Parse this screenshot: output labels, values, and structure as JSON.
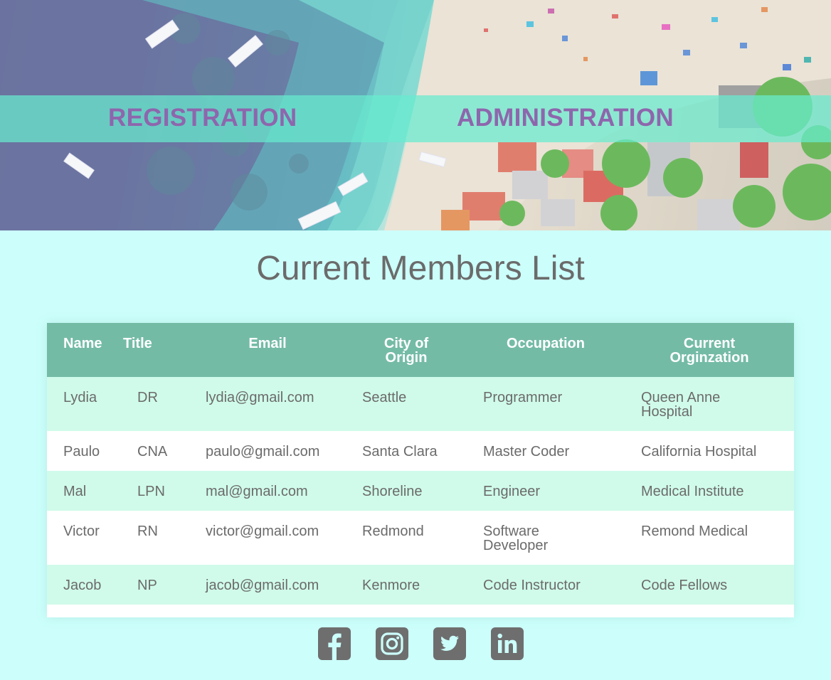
{
  "nav": {
    "registration": "REGISTRATION",
    "administration": "ADMINISTRATION"
  },
  "page_title": "Current Members List",
  "table": {
    "headers": {
      "name": "Name",
      "title": "Title",
      "email": "Email",
      "city_line1": "City of",
      "city_line2": "Origin",
      "occupation": "Occupation",
      "org_line1": "Current",
      "org_line2": "Orginzation"
    },
    "rows": [
      {
        "name": "Lydia",
        "title": "DR",
        "email": "lydia@gmail.com",
        "city": "Seattle",
        "occupation": "Programmer",
        "organization": "Queen Anne Hospital"
      },
      {
        "name": "Paulo",
        "title": "CNA",
        "email": "paulo@gmail.com",
        "city": "Santa Clara",
        "occupation": "Master Coder",
        "organization": "California Hospital"
      },
      {
        "name": "Mal",
        "title": "LPN",
        "email": "mal@gmail.com",
        "city": "Shoreline",
        "occupation": "Engineer",
        "organization": "Medical Institute"
      },
      {
        "name": "Victor",
        "title": "RN",
        "email": "victor@gmail.com",
        "city": "Redmond",
        "occupation": "Software Developer",
        "organization": "Remond Medical"
      },
      {
        "name": "Jacob",
        "title": "NP",
        "email": "jacob@gmail.com",
        "city": "Kenmore",
        "occupation": "Code Instructor",
        "organization": "Code Fellows"
      }
    ]
  },
  "social": [
    {
      "icon": "facebook-icon"
    },
    {
      "icon": "instagram-icon"
    },
    {
      "icon": "twitter-icon"
    },
    {
      "icon": "linkedin-icon"
    }
  ],
  "colors": {
    "page_bg": "#ccfffb",
    "nav_band": "#68ecce",
    "nav_text": "#8e66ad",
    "table_header": "#74bba6",
    "row_alt": "#d0fbea",
    "text": "#6b6b6b",
    "icon": "#6e6e6e"
  }
}
